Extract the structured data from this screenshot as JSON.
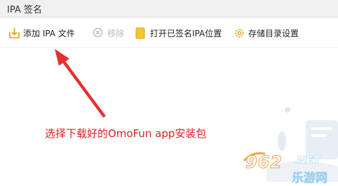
{
  "window": {
    "title": "IPA 签名"
  },
  "toolbar": {
    "add_ipa_label": "添加 IPA 文件",
    "remove_label": "移除",
    "open_folder_label": "打开已签名IPA位置",
    "storage_settings_label": "存储目录设置"
  },
  "annotation": {
    "text": "选择下载好的OmoFun app安装包",
    "color": "#e02020"
  },
  "watermark": {
    "number": "962",
    "dot": ".",
    "site": "NET",
    "subtitle": "乐游网"
  },
  "colors": {
    "accent_gold": "#e2a21a",
    "folder_yellow": "#f3c532",
    "disabled_gray": "#b8b8b8"
  }
}
